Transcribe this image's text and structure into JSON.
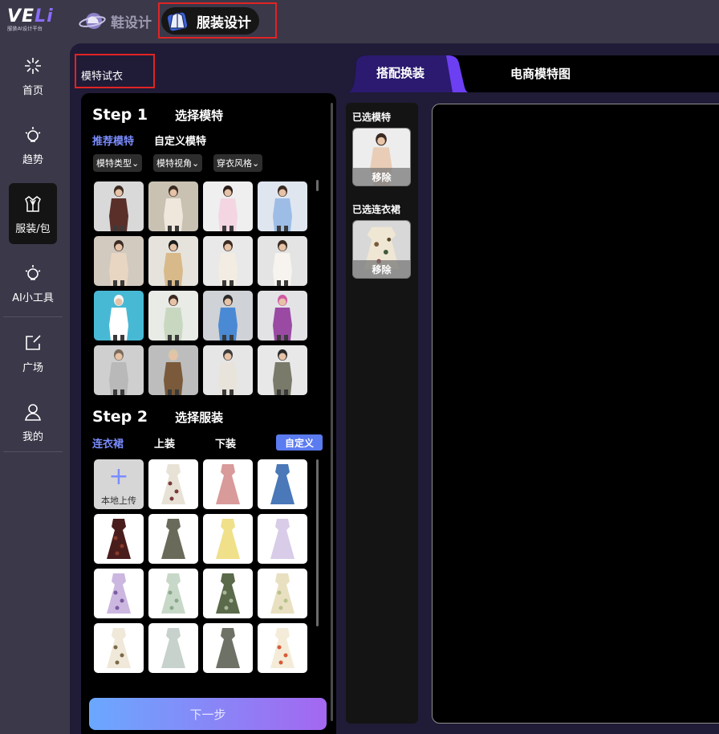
{
  "header": {
    "logo_text": "VELi",
    "logo_sub": "服装AI设计平台",
    "tabs": [
      {
        "label": "鞋设计",
        "icon": "shoe-planet-icon"
      },
      {
        "label": "服装设计",
        "icon": "jacket-icon"
      }
    ]
  },
  "sidebar": {
    "items": [
      {
        "label": "首页",
        "icon": "sparkle-icon"
      },
      {
        "label": "趋势",
        "icon": "bulb-icon"
      },
      {
        "label": "服装/包",
        "icon": "suit-icon"
      },
      {
        "label": "AI小工具",
        "icon": "bulb-icon"
      },
      {
        "label": "广场",
        "icon": "edit-icon"
      },
      {
        "label": "我的",
        "icon": "user-icon"
      }
    ]
  },
  "page_title": "模特试衣",
  "step1": {
    "num": "Step 1",
    "title": "选择模特",
    "tabs": [
      "推荐模特",
      "自定义模特"
    ],
    "filters": [
      "模特类型",
      "模特视角",
      "穿衣风格"
    ]
  },
  "step2": {
    "num": "Step 2",
    "title": "选择服装",
    "tabs": [
      "连衣裙",
      "上装",
      "下装"
    ],
    "custom_label": "自定义",
    "upload_label": "本地上传"
  },
  "next_label": "下一步",
  "selected": {
    "model_label": "已选模特",
    "dress_label": "已选连衣裙",
    "remove_label": "移除"
  },
  "right_tabs": [
    "搭配换装",
    "电商模特图"
  ],
  "colors": {
    "accent": "#7a8cff",
    "panel_bg": "#201b36",
    "highlight_box": "#e02424"
  }
}
